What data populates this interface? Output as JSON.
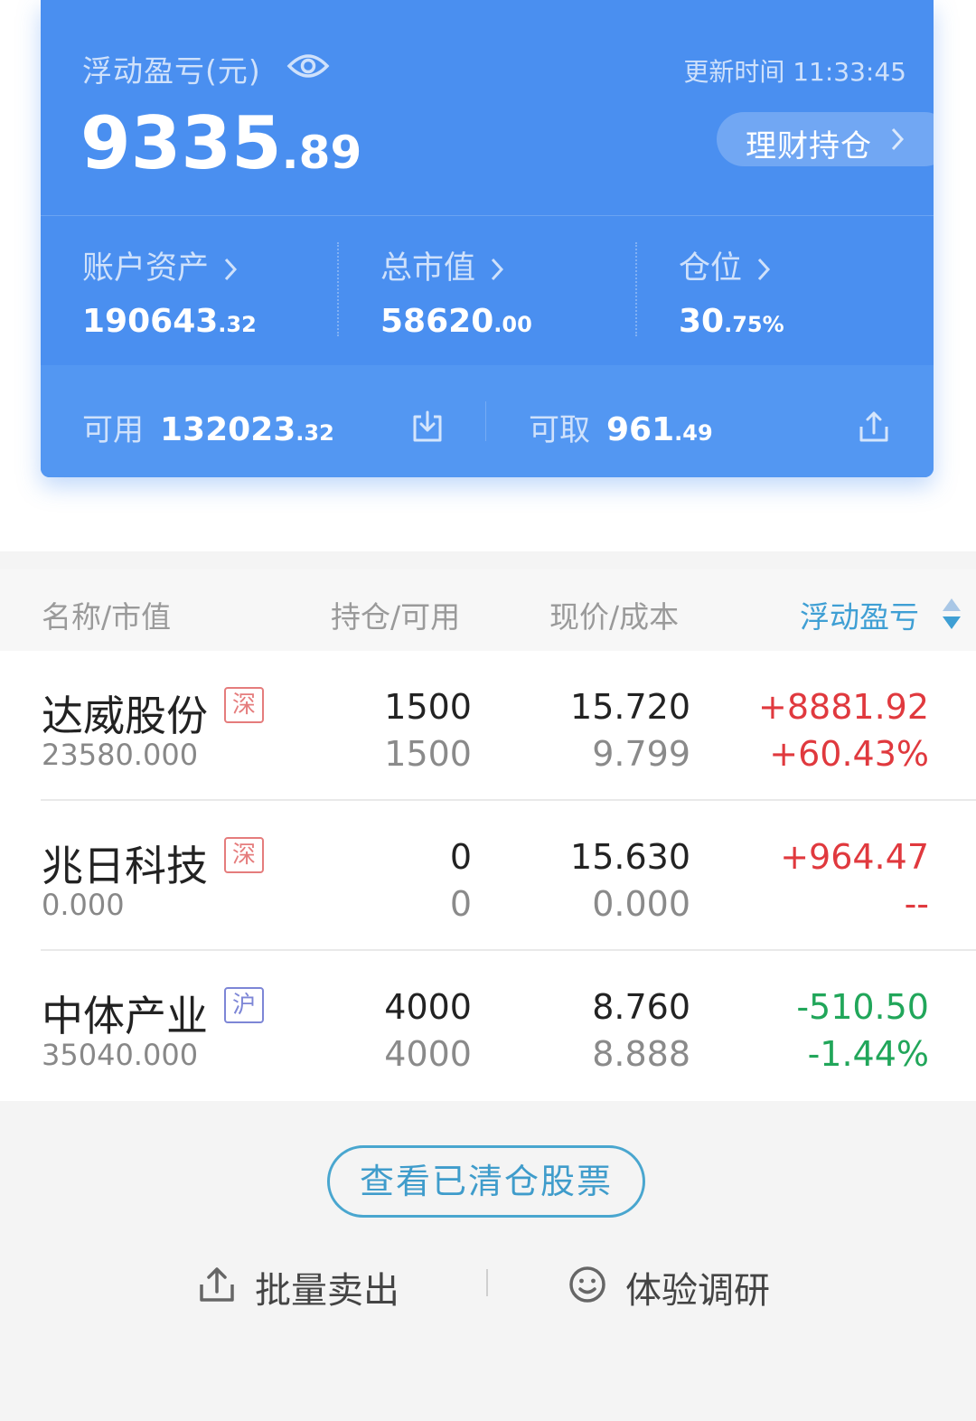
{
  "account_card": {
    "floating_pl_label": "浮动盈亏(元)",
    "update_time": "更新时间 11:33:45",
    "floating_pl_int": "9335",
    "floating_pl_dec": ".89",
    "wealth_button_label": "理财持仓",
    "stats": [
      {
        "label": "账户资产",
        "value_int": "190643",
        "value_dec": ".32"
      },
      {
        "label": "总市值",
        "value_int": "58620",
        "value_dec": ".00"
      },
      {
        "label": "仓位",
        "value_int": "30",
        "value_dec": ".75%"
      }
    ],
    "available": {
      "label": "可用",
      "value_int": "132023",
      "value_dec": ".32"
    },
    "withdrawable": {
      "label": "可取",
      "value_int": "961",
      "value_dec": ".49"
    }
  },
  "table": {
    "headers": {
      "name": "名称/市值",
      "position": "持仓/可用",
      "price": "现价/成本",
      "pl": "浮动盈亏"
    },
    "rows": [
      {
        "name": "达威股份",
        "market": "深",
        "market_value": "23580.000",
        "position": "1500",
        "available": "1500",
        "price": "15.720",
        "cost": "9.799",
        "pl": "+8881.92",
        "pl_pct": "+60.43%",
        "trend": "up"
      },
      {
        "name": "兆日科技",
        "market": "深",
        "market_value": "0.000",
        "position": "0",
        "available": "0",
        "price": "15.630",
        "cost": "0.000",
        "pl": "+964.47",
        "pl_pct": "--",
        "trend": "up"
      },
      {
        "name": "中体产业",
        "market": "沪",
        "market_value": "35040.000",
        "position": "4000",
        "available": "4000",
        "price": "8.760",
        "cost": "8.888",
        "pl": "-510.50",
        "pl_pct": "-1.44%",
        "trend": "down"
      }
    ]
  },
  "cleared_button_label": "查看已清仓股票",
  "actions": {
    "batch_sell": "批量卖出",
    "survey": "体验调研"
  },
  "colors": {
    "card_blue": "#4a8ff0",
    "gain_red": "#e0393e",
    "loss_green": "#21a65a",
    "accent_teal": "#3f9ccb"
  },
  "icons": [
    "eye-icon",
    "chevron-right-icon",
    "download-icon",
    "upload-icon",
    "sort-icon",
    "smiley-icon"
  ]
}
